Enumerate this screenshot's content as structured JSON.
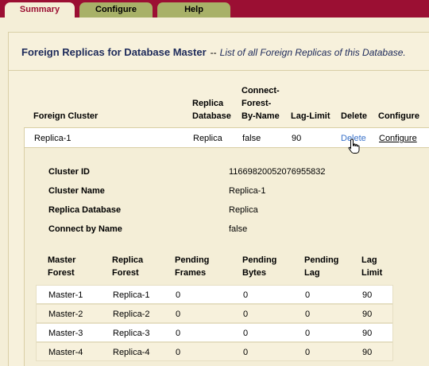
{
  "tabs": [
    {
      "label": "Summary",
      "active": true
    },
    {
      "label": "Configure",
      "active": false
    },
    {
      "label": "Help",
      "active": false
    }
  ],
  "colors": {
    "tab_bar": "#9b0f33",
    "tab_inactive": "#a8b168",
    "panel_bg": "#f4eed7",
    "title_text": "#1d2a5a",
    "link": "#3a72c9"
  },
  "page": {
    "title": "Foreign Replicas for Database Master",
    "separator": "--",
    "subtitle": "List of all Foreign Replicas of this Database."
  },
  "replicas_table": {
    "headers": {
      "foreign_cluster": "Foreign Cluster",
      "replica_database_1": "Replica",
      "replica_database_2": "Database",
      "connect_1": "Connect-",
      "connect_2": "Forest-",
      "connect_3": "By-Name",
      "lag_limit": "Lag-Limit",
      "delete": "Delete",
      "configure": "Configure"
    },
    "rows": [
      {
        "cluster": "Replica-1",
        "database": "Replica",
        "connect_by_name": "false",
        "lag_limit": "90",
        "delete": "Delete",
        "configure": "Configure"
      }
    ]
  },
  "details": {
    "cluster_id_label": "Cluster ID",
    "cluster_id": "11669820052076955832",
    "cluster_name_label": "Cluster Name",
    "cluster_name": "Replica-1",
    "replica_database_label": "Replica Database",
    "replica_database": "Replica",
    "connect_by_name_label": "Connect by Name",
    "connect_by_name": "false"
  },
  "forest_table": {
    "headers": {
      "master_1": "Master",
      "master_2": "Forest",
      "replica_1": "Replica",
      "replica_2": "Forest",
      "frames_1": "Pending",
      "frames_2": "Frames",
      "bytes_1": "Pending",
      "bytes_2": "Bytes",
      "lag_1": "Pending",
      "lag_2": "Lag",
      "limit_1": "Lag",
      "limit_2": "Limit"
    },
    "rows": [
      {
        "master": "Master-1",
        "replica": "Replica-1",
        "frames": "0",
        "bytes": "0",
        "lag": "0",
        "limit": "90"
      },
      {
        "master": "Master-2",
        "replica": "Replica-2",
        "frames": "0",
        "bytes": "0",
        "lag": "0",
        "limit": "90"
      },
      {
        "master": "Master-3",
        "replica": "Replica-3",
        "frames": "0",
        "bytes": "0",
        "lag": "0",
        "limit": "90"
      },
      {
        "master": "Master-4",
        "replica": "Replica-4",
        "frames": "0",
        "bytes": "0",
        "lag": "0",
        "limit": "90"
      }
    ]
  },
  "icons": {
    "cursor": "hand-pointer-icon"
  }
}
